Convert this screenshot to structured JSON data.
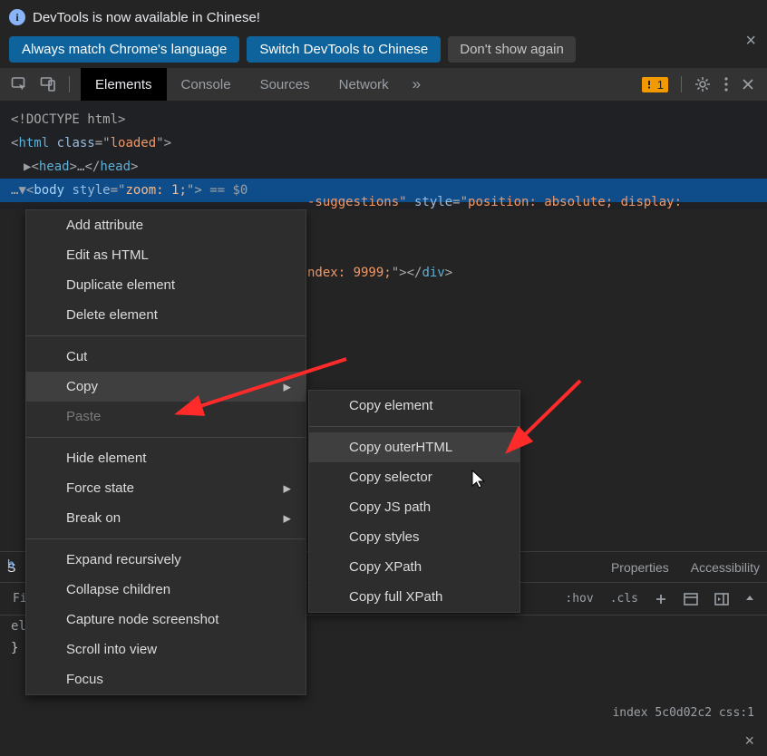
{
  "infobar": {
    "message": "DevTools is now available in Chinese!",
    "btn_match": "Always match Chrome's language",
    "btn_switch": "Switch DevTools to Chinese",
    "btn_dismiss": "Don't show again"
  },
  "toolbar": {
    "tabs": [
      "Elements",
      "Console",
      "Sources",
      "Network"
    ],
    "warn_count": "1"
  },
  "elements_code": {
    "l1": "<!DOCTYPE html>",
    "l2_open": "<",
    "l2_tag": "html",
    "l2_attr": " class",
    "l2_eq": "=\"",
    "l2_val": "loaded",
    "l2_close": "\">",
    "l3_open": "<",
    "l3_tag": "head",
    "l3_mid": ">…</",
    "l3_tag2": "head",
    "l3_close": ">",
    "l4_open": "<",
    "l4_tag": "body",
    "l4_attr": " style",
    "l4_eq": "=\"",
    "l4_val": "zoom: 1;",
    "l4_close": "\">",
    "l4_sel": " == $0",
    "frag_mid": "-suggestions\"",
    "frag_attr": " style",
    "frag_eq": "=\"",
    "frag_val1": "position: absolute; display:",
    "frag_line2a": "ndex: 9999;",
    "frag_line2_close": "\"></",
    "frag_line2_tag": "div",
    "frag_line2_end": ">"
  },
  "context_menu_1": [
    {
      "label": "Add attribute",
      "sub": false
    },
    {
      "label": "Edit as HTML",
      "sub": false
    },
    {
      "label": "Duplicate element",
      "sub": false
    },
    {
      "label": "Delete element",
      "sub": false
    },
    {
      "sep": true
    },
    {
      "label": "Cut",
      "sub": false
    },
    {
      "label": "Copy",
      "sub": true,
      "hover": true
    },
    {
      "label": "Paste",
      "sub": false,
      "disabled": true
    },
    {
      "sep": true
    },
    {
      "label": "Hide element",
      "sub": false
    },
    {
      "label": "Force state",
      "sub": true
    },
    {
      "label": "Break on",
      "sub": true
    },
    {
      "sep": true
    },
    {
      "label": "Expand recursively",
      "sub": false
    },
    {
      "label": "Collapse children",
      "sub": false
    },
    {
      "label": "Capture node screenshot",
      "sub": false
    },
    {
      "label": "Scroll into view",
      "sub": false
    },
    {
      "label": "Focus",
      "sub": false
    }
  ],
  "context_menu_2": [
    {
      "label": "Copy element"
    },
    {
      "sep": true
    },
    {
      "label": "Copy outerHTML",
      "hover": true
    },
    {
      "label": "Copy selector"
    },
    {
      "label": "Copy JS path"
    },
    {
      "label": "Copy styles"
    },
    {
      "label": "Copy XPath"
    },
    {
      "label": "Copy full XPath"
    }
  ],
  "bottom_pane": {
    "tabs_right": [
      "Properties",
      "Accessibility"
    ],
    "styles_tab_short": "S",
    "filter_short": "Fi",
    "el_short": "el",
    "brace": "}",
    "hov": ":hov",
    "cls": ".cls",
    "note": "index 5c0d02c2 css:1",
    "breadcrumb_short": "h"
  }
}
